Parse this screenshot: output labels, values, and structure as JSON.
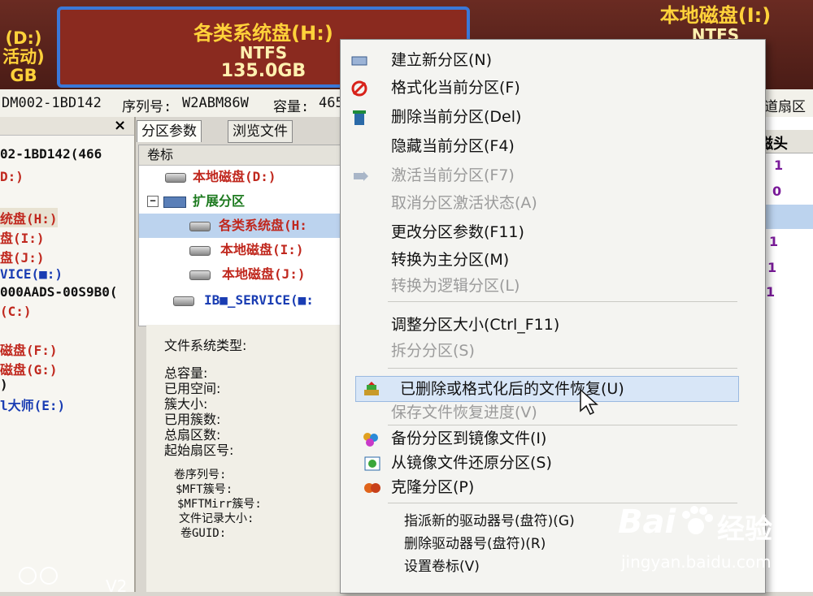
{
  "disk_bar": {
    "left_partition": {
      "name": "(D:)",
      "status": "活动)",
      "size": "GB"
    },
    "selected_partition": {
      "name": "各类系统盘(H:)",
      "fs": "NTFS",
      "size": "135.0GB"
    },
    "right_partition": {
      "name": "本地磁盘(I:)",
      "fs": "NTFS"
    }
  },
  "info_line": {
    "model": "DM002-1BD142",
    "serial_label": "序列号:",
    "serial": "W2ABM86W",
    "capacity_label": "容量:",
    "capacity": "465",
    "sectors_label": "道扇区"
  },
  "left_tree": {
    "close_glyph": "×",
    "items": [
      {
        "text": "02-1BD142(466",
        "color": "black"
      },
      {
        "text": "D:)",
        "color": "red"
      },
      {
        "text": "统盘(H:)",
        "color": "red"
      },
      {
        "text": "盘(I:)",
        "color": "red"
      },
      {
        "text": "盘(J:)",
        "color": "red"
      },
      {
        "text": "VICE(■:)",
        "color": "blue"
      },
      {
        "text": "000AADS-00S9B0(",
        "color": "black"
      },
      {
        "text": "(C:)",
        "color": "red"
      },
      {
        "text": "磁盘(F:)",
        "color": "red"
      },
      {
        "text": "磁盘(G:)",
        "color": "red"
      },
      {
        "text": ")",
        "color": "black"
      },
      {
        "text": "l大师(E:)",
        "color": "blue"
      }
    ]
  },
  "tabs": [
    {
      "label": "分区参数"
    },
    {
      "label": "浏览文件"
    }
  ],
  "partition_list": {
    "header": "卷标",
    "rows": [
      {
        "label": "本地磁盘(D:)",
        "color": "red"
      },
      {
        "label": "扩展分区",
        "color": "green",
        "expander": "−"
      },
      {
        "label": "各类系统盘(H:",
        "color": "red"
      },
      {
        "label": "本地磁盘(I:)",
        "color": "red"
      },
      {
        "label": "本地磁盘(J:)",
        "color": "red"
      },
      {
        "label": "IB■_SERVICE(■:",
        "color": "blue"
      }
    ]
  },
  "properties": {
    "fs_type": "文件系统类型:",
    "total": "总容量:",
    "used": "已用空间:",
    "cluster": "簇大小:",
    "used_clusters": "已用簇数:",
    "total_sectors": "总扇区数:",
    "start_sector": "起始扇区号:",
    "vol_serial": "卷序列号:",
    "mft": "$MFT簇号:",
    "mftmirr": "$MFTMirr簇号:",
    "record_size": "文件记录大小:",
    "guid": "卷GUID:"
  },
  "right_grid": {
    "header": "磁头",
    "values": [
      "1",
      "0",
      "1",
      "1",
      "1",
      "1"
    ]
  },
  "context_menu": {
    "items": [
      {
        "label": "建立新分区(N)",
        "disabled": false
      },
      {
        "label": "格式化当前分区(F)",
        "disabled": false
      },
      {
        "label": "删除当前分区(Del)",
        "disabled": false
      },
      {
        "label": "隐藏当前分区(F4)",
        "disabled": false
      },
      {
        "label": "激活当前分区(F7)",
        "disabled": true
      },
      {
        "label": "取消分区激活状态(A)",
        "disabled": true
      },
      {
        "label": "更改分区参数(F11)",
        "disabled": false
      },
      {
        "label": "转换为主分区(M)",
        "disabled": false
      },
      {
        "label": "转换为逻辑分区(L)",
        "disabled": true
      },
      {
        "label": "调整分区大小(Ctrl_F11)",
        "disabled": false
      },
      {
        "label": "拆分分区(S)",
        "disabled": true
      },
      {
        "label": "已删除或格式化后的文件恢复(U)",
        "disabled": false,
        "highlighted": true
      },
      {
        "label": "保存文件恢复进度(V)",
        "disabled": true
      },
      {
        "label": "备份分区到镜像文件(I)",
        "disabled": false
      },
      {
        "label": "从镜像文件还原分区(S)",
        "disabled": false
      },
      {
        "label": "克隆分区(P)",
        "disabled": false
      },
      {
        "label": "指派新的驱动器号(盘符)(G)",
        "disabled": false
      },
      {
        "label": "删除驱动器号(盘符)(R)",
        "disabled": false
      },
      {
        "label": "设置卷标(V)",
        "disabled": false
      }
    ],
    "icons": [
      "new-partition-icon",
      "format-icon",
      "trash-icon",
      "hide-icon",
      "activate-icon",
      "recover-files-icon",
      "backup-icon",
      "restore-icon",
      "clone-icon"
    ]
  },
  "watermark": {
    "brand": "Bai",
    "suffix": "经验",
    "url": "jingyan.baidu.com"
  },
  "bottom_left": {
    "text": "V2"
  }
}
